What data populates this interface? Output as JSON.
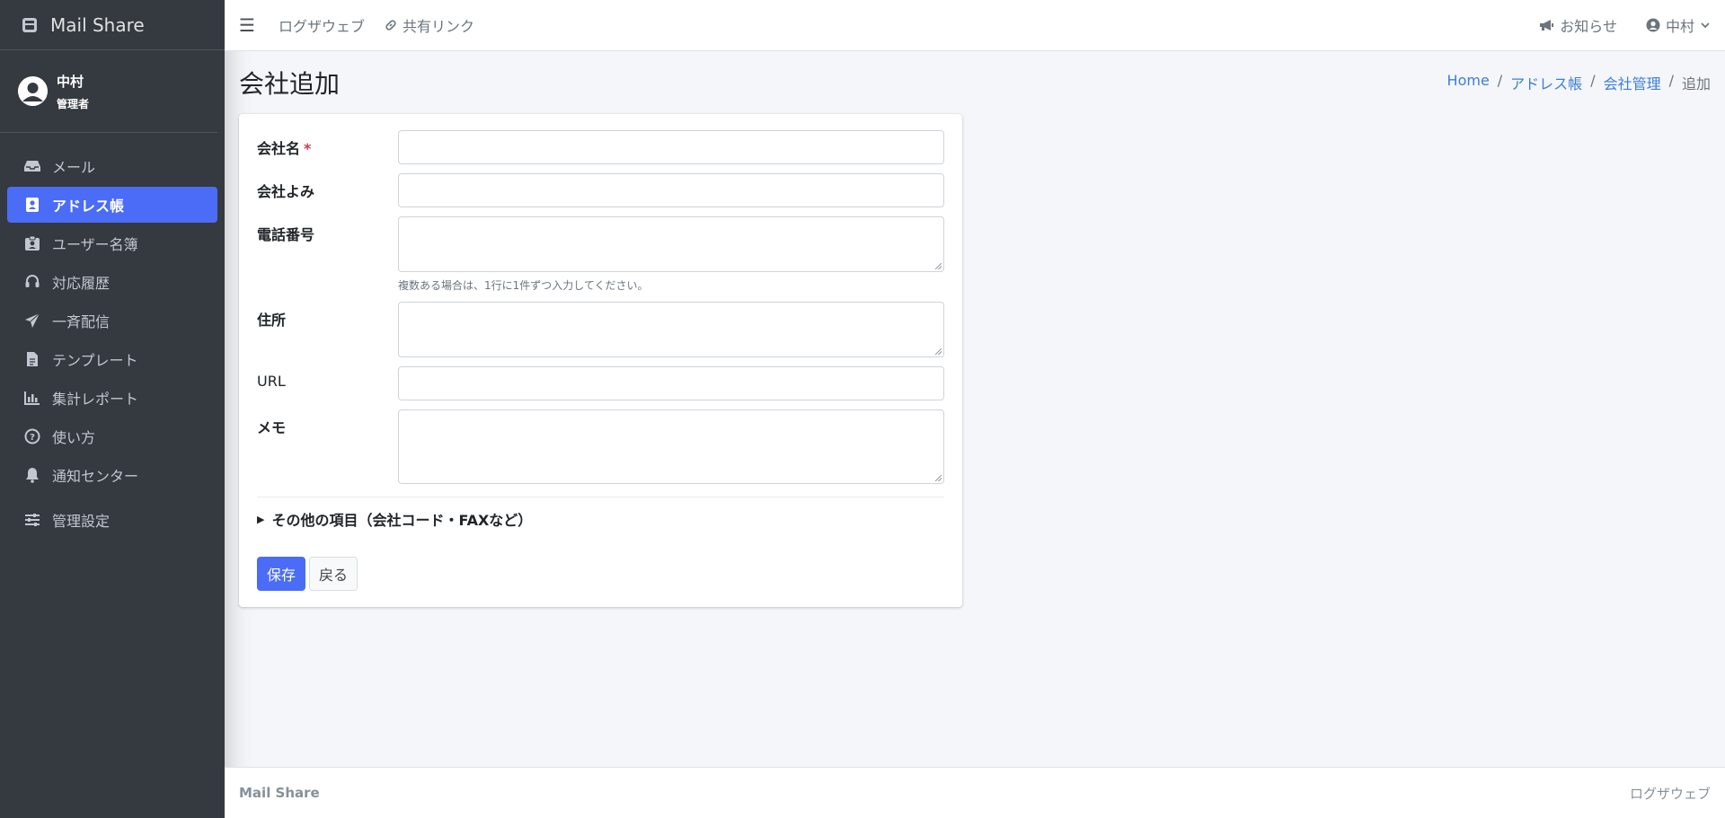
{
  "brand": {
    "name": "Mail Share"
  },
  "user": {
    "name": "中村",
    "role": "管理者"
  },
  "nav": {
    "items": [
      {
        "label": "メール",
        "icon": "inbox-icon"
      },
      {
        "label": "アドレス帳",
        "icon": "address-book-icon",
        "active": true
      },
      {
        "label": "ユーザー名簿",
        "icon": "id-badge-icon"
      },
      {
        "label": "対応履歴",
        "icon": "headset-icon"
      },
      {
        "label": "一斉配信",
        "icon": "paper-plane-icon"
      },
      {
        "label": "テンプレート",
        "icon": "file-text-icon"
      },
      {
        "label": "集計レポート",
        "icon": "bar-chart-icon"
      },
      {
        "label": "使い方",
        "icon": "question-circle-icon"
      },
      {
        "label": "通知センター",
        "icon": "bell-icon"
      },
      {
        "label": "管理設定",
        "icon": "sliders-icon"
      }
    ]
  },
  "topbar": {
    "links": [
      "ログザウェブ",
      "共有リンク"
    ],
    "notice": "お知らせ",
    "user_menu": "中村"
  },
  "page": {
    "title": "会社追加",
    "breadcrumb": [
      "Home",
      "アドレス帳",
      "会社管理",
      "追加"
    ]
  },
  "form": {
    "company_name": "会社名",
    "required_mark": "*",
    "company_kana": "会社よみ",
    "phone": "電話番号",
    "phone_help": "複数ある場合は、1行に1件ずつ入力してください。",
    "address": "住所",
    "url": "URL",
    "memo": "メモ",
    "more": "その他の項目（会社コード・FAXなど）",
    "save": "保存",
    "back": "戻る"
  },
  "footer": {
    "left": "Mail Share",
    "right": "ログザウェブ"
  },
  "colors": {
    "accent": "#4a6cf7",
    "sidebar": "#343a40",
    "link": "#3d7ddb"
  }
}
